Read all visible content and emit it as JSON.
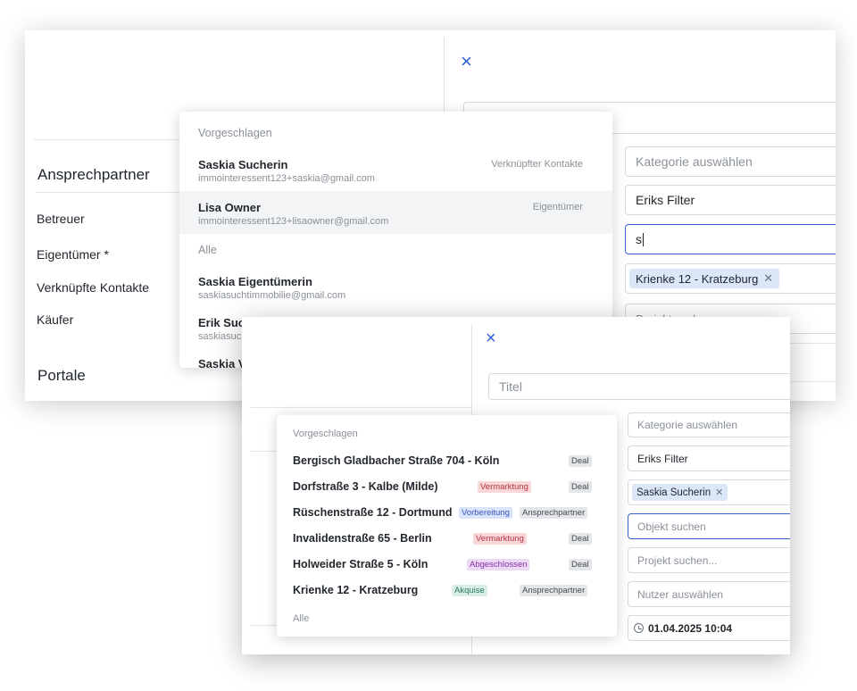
{
  "back": {
    "close_label": "×",
    "sections": {
      "contacts": "Ansprechpartner",
      "portals": "Portale"
    },
    "contact_labels": [
      "Betreuer",
      "Eigentümer *",
      "Verknüpfte Kontakte",
      "Käufer"
    ],
    "fields": {
      "category_placeholder": "Kategorie auswählen",
      "filter_value": "Eriks Filter",
      "search_value": "s",
      "object_chip": "Krienke 12 - Kratzeburg",
      "project_placeholder": "Projekt suchen"
    },
    "dropdown": {
      "suggested_heading": "Vorgeschlagen",
      "all_heading": "Alle",
      "suggested": [
        {
          "name": "Saskia Sucherin",
          "email": "immointeressent123+saskia@gmail.com",
          "role": "Verknüpfter Kontakte"
        },
        {
          "name": "Lisa Owner",
          "email": "immointeressent123+lisaowner@gmail.com",
          "role": "Eigentümer"
        }
      ],
      "all": [
        {
          "name": "Saskia Eigentümerin",
          "email": "saskiasuchtimmobilie@gmail.com"
        },
        {
          "name": "Erik Suc",
          "email": "saskiasuc"
        },
        {
          "name": "Saskia V",
          "email": ""
        }
      ]
    }
  },
  "front": {
    "close_label": "×",
    "fields": {
      "title_placeholder": "Titel",
      "category_placeholder": "Kategorie auswählen",
      "filter_value": "Eriks Filter",
      "contact_chip": "Saskia Sucherin",
      "object_placeholder": "Objekt suchen",
      "project_placeholder": "Projekt suchen...",
      "user_placeholder": "Nutzer auswählen",
      "datetime_value": "01.04.2025 10:04"
    },
    "dropdown": {
      "suggested_heading": "Vorgeschlagen",
      "all_heading": "Alle",
      "objects": [
        {
          "name": "Bergisch Gladbacher Straße 704 - Köln",
          "status": "",
          "type": "Deal"
        },
        {
          "name": "Dorfstraße 3 - Kalbe (Milde)",
          "status": "Vermarktung",
          "type": "Deal"
        },
        {
          "name": "Rüschenstraße 12 - Dortmund",
          "status": "Vorbereitung",
          "type": "Ansprechpartner"
        },
        {
          "name": "Invalidenstraße 65 - Berlin",
          "status": "Vermarktung",
          "type": "Deal"
        },
        {
          "name": "Holweider Straße 5 - Köln",
          "status": "Abgeschlossen",
          "type": "Deal"
        },
        {
          "name": "Krienke 12 - Kratzeburg",
          "status": "Akquise",
          "type": "Ansprechpartner"
        }
      ]
    }
  }
}
